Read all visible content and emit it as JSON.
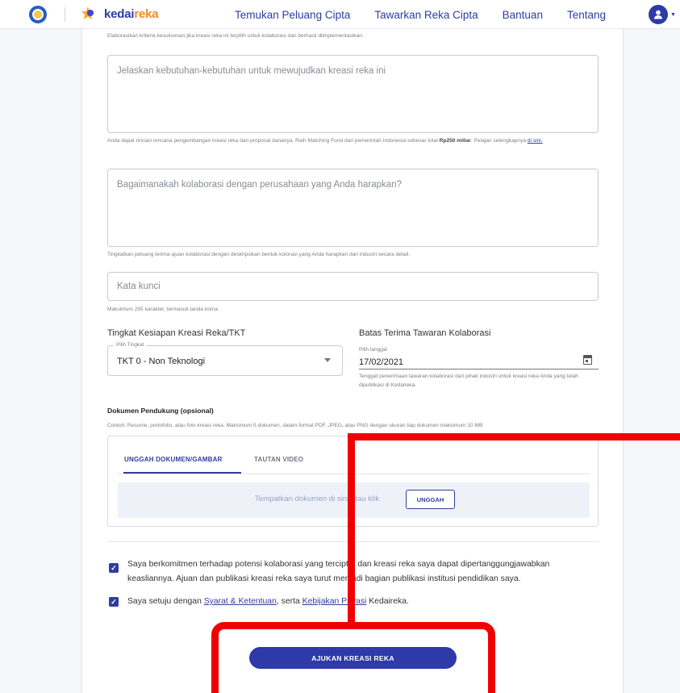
{
  "navbar": {
    "brand_main": "kedai",
    "brand_accent": "reka",
    "links": [
      "Temukan Peluang Cipta",
      "Tawarkan Reka Cipta",
      "Bantuan",
      "Tentang"
    ]
  },
  "form": {
    "top_helper": "Elaborasikan kriteria kesuksesan jika kreasi reka ini terpilih untuk kolaborasi dan berhasil diimplementasikan.",
    "needs_placeholder": "Jelaskan kebutuhan-kebutuhan untuk mewujudkan kreasi reka ini",
    "needs_helper_part1": "Anda dapat rincian rencana pengembangan kreasi reka dan proposal dananya. Raih Matching Fund dari pemerintah Indonesia sebesar total ",
    "needs_helper_amount": "Rp250 miliar",
    "needs_helper_part2": ". Pelajari selengkapnya ",
    "needs_helper_link": "di sini.",
    "collab_placeholder": "Bagaimanakah kolaborasi dengan perusahaan yang Anda harapkan?",
    "collab_helper": "Tingkatkan peluang terima ajuan kolaborasi dengan deskripsikan bentuk kolorasi yang Anda harapkan dari industri secara detail.",
    "keyword_placeholder": "Kata kunci",
    "keyword_helper": "Maksimum 255 karakter, termasuk tanda koma",
    "tkt_label": "Tingkat Kesiapan Kreasi Reka/TKT",
    "tkt_legend": "Pilih Tingkat",
    "tkt_value": "TKT 0 - Non Teknologi",
    "deadline_label": "Batas Terima Tawaran Kolaborasi",
    "deadline_legend": "Pilih tanggal",
    "deadline_value": "17/02/2021",
    "deadline_helper": "Tenggat penerimaan tawaran kolaborasi dari pihak industri untuk kreasi reka Anda yang telah dipublikasi di Kedaireka.",
    "docs_label": "Dokumen Pendukung (opsional)",
    "docs_helper": "Contoh: Resume, portofolio, atau foto kreasi reka. Maksimum 5 dokumen, dalam format PDF, JPEG, atau PNG dengan ukuran tiap dokumen maksimum 10 MB",
    "tab_upload": "UNGGAH DOKUMEN/GAMBAR",
    "tab_video": "TAUTAN VIDEO",
    "drop_text": "Tempatkan dokumen di sini atau klik",
    "upload_button": "UNGGAH",
    "commit_text": "Saya berkomitmen terhadap potensi kolaborasi yang tercipta, dan kreasi reka saya dapat dipertanggungjawabkan keasliannya. Ajuan dan publikasi kreasi reka saya turut menjadi bagian publikasi institusi pendidikan saya.",
    "agree_prefix": "Saya setuju dengan ",
    "agree_link1": "Syarat & Ketentuan",
    "agree_mid": ", serta ",
    "agree_link2": "Kebijakan Privasi",
    "agree_suffix": " Kedaireka.",
    "submit_button": "AJUKAN KREASI REKA"
  },
  "colors": {
    "primary": "#2d3aa7",
    "accent": "#f08a24",
    "annotation": "#f00000"
  }
}
